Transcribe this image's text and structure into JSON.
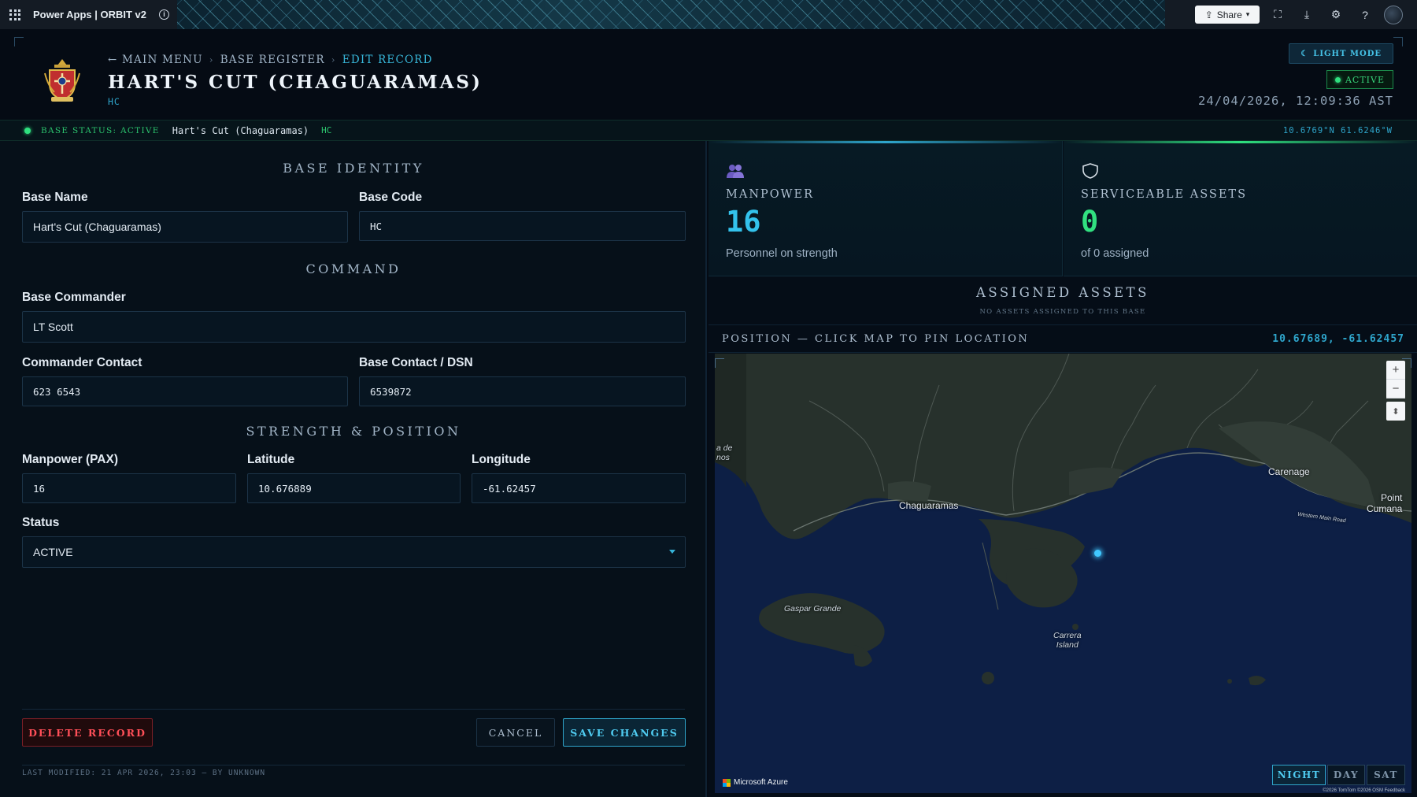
{
  "app_bar": {
    "title": "Power Apps  |  ORBIT v2",
    "share_label": "Share"
  },
  "header": {
    "breadcrumb": [
      "← MAIN MENU",
      "BASE REGISTER",
      "EDIT RECORD"
    ],
    "title": "HART'S CUT (CHAGUARAMAS)",
    "code": "HC",
    "light_mode_label": "LIGHT MODE",
    "active_label": "ACTIVE",
    "datetime": "24/04/2026, 12:09:36 AST"
  },
  "status_strip": {
    "label": "BASE STATUS: ACTIVE",
    "name": "Hart's Cut (Chaguaramas)",
    "code": "HC",
    "coords": "10.6769°N  61.6246°W"
  },
  "form": {
    "sections": {
      "identity": "BASE IDENTITY",
      "command": "COMMAND",
      "strength": "STRENGTH & POSITION"
    },
    "fields": {
      "base_name": {
        "label": "Base Name",
        "value": "Hart's Cut (Chaguaramas)"
      },
      "base_code": {
        "label": "Base Code",
        "value": "HC"
      },
      "base_commander": {
        "label": "Base Commander",
        "value": "LT Scott"
      },
      "commander_contact": {
        "label": "Commander Contact",
        "value": "623 6543"
      },
      "base_contact": {
        "label": "Base Contact / DSN",
        "value": "6539872"
      },
      "manpower": {
        "label": "Manpower (PAX)",
        "value": "16"
      },
      "latitude": {
        "label": "Latitude",
        "value": "10.676889"
      },
      "longitude": {
        "label": "Longitude",
        "value": "-61.62457"
      },
      "status": {
        "label": "Status",
        "value": "ACTIVE"
      }
    },
    "buttons": {
      "delete": "DELETE RECORD",
      "cancel": "CANCEL",
      "save": "SAVE CHANGES"
    },
    "last_modified": "LAST MODIFIED: 21 APR 2026, 23:03 — BY UNKNOWN"
  },
  "kpis": {
    "manpower": {
      "label": "MANPOWER",
      "value": "16",
      "sub": "Personnel on strength",
      "icon": "people-icon",
      "color": "#33c2ec"
    },
    "assets": {
      "label": "SERVICEABLE ASSETS",
      "value": "0",
      "sub": "of 0 assigned",
      "icon": "shield-icon",
      "color": "#31e080"
    }
  },
  "assigned_assets": {
    "title": "ASSIGNED ASSETS",
    "subtitle": "NO ASSETS ASSIGNED TO THIS BASE"
  },
  "map": {
    "position_label": "POSITION — CLICK MAP TO PIN LOCATION",
    "position_coords": "10.67689, -61.62457",
    "labels": {
      "chaguaramas": "Chaguaramas",
      "carenage": "Carenage",
      "point_cumana": "Point\nCumana",
      "gaspar_grande": "Gaspar Grande",
      "carrera_island": "Carrera\nIsland",
      "west_edge": "a de\nnos",
      "western_main_road": "Western Main Road"
    },
    "attribution": "Microsoft Azure",
    "copyright": "©2026 TomTom ©2026 OSM Feedback",
    "styles": [
      "NIGHT",
      "DAY",
      "SAT"
    ],
    "active_style": "NIGHT",
    "zoom_in": "+",
    "zoom_out": "−"
  }
}
